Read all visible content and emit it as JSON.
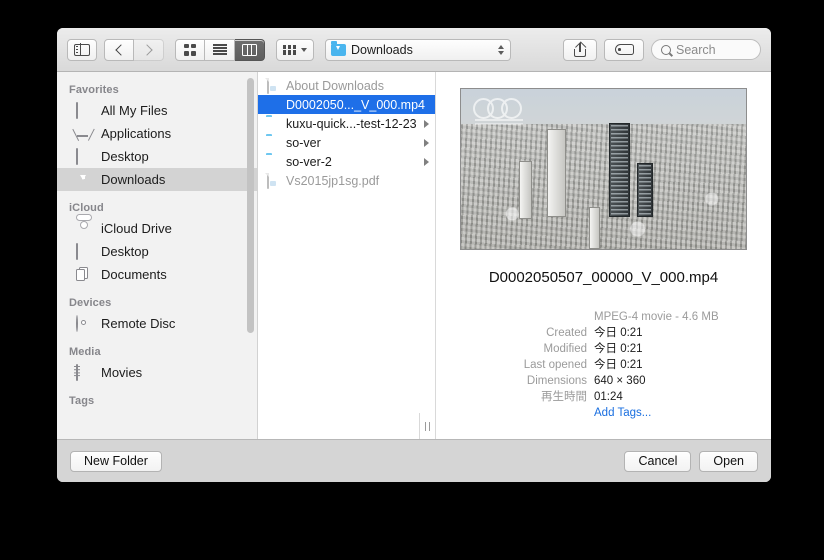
{
  "toolbar": {
    "sidebar_toggle_icon": "sidebar-toggle-icon",
    "back_icon": "chevron-left-icon",
    "forward_icon": "chevron-right-icon",
    "view_icon_label": "icon-view-icon",
    "view_list_label": "list-view-icon",
    "view_column_label": "column-view-icon",
    "arrange_icon": "arrange-grid-icon",
    "path_label": "Downloads",
    "path_icon": "downloads-folder-icon",
    "stepper_icon": "up-down-stepper-icon",
    "share_icon": "share-icon",
    "tag_icon": "tag-icon",
    "search_placeholder": "Search",
    "search_value": "",
    "search_icon": "magnifier-icon"
  },
  "sidebar": {
    "sections": [
      {
        "header": "Favorites",
        "items": [
          {
            "label": "All My Files",
            "icon": "all-my-files-icon",
            "selected": false
          },
          {
            "label": "Applications",
            "icon": "applications-icon",
            "selected": false
          },
          {
            "label": "Desktop",
            "icon": "desktop-icon",
            "selected": false
          },
          {
            "label": "Downloads",
            "icon": "downloads-icon",
            "selected": true
          }
        ]
      },
      {
        "header": "iCloud",
        "items": [
          {
            "label": "iCloud Drive",
            "icon": "icloud-drive-icon",
            "selected": false
          },
          {
            "label": "Desktop",
            "icon": "desktop-icon",
            "selected": false
          },
          {
            "label": "Documents",
            "icon": "documents-icon",
            "selected": false
          }
        ]
      },
      {
        "header": "Devices",
        "items": [
          {
            "label": "Remote Disc",
            "icon": "remote-disc-icon",
            "selected": false
          }
        ]
      },
      {
        "header": "Media",
        "items": [
          {
            "label": "Movies",
            "icon": "movies-icon",
            "selected": false
          }
        ]
      },
      {
        "header": "Tags",
        "items": []
      }
    ]
  },
  "file_list": {
    "rows": [
      {
        "name": "About Downloads",
        "icon": "document-icon",
        "selected": false,
        "dimmed": true,
        "has_arrow": false
      },
      {
        "name": "D0002050..._V_000.mp4",
        "icon": "movie-thumbnail-icon",
        "selected": true,
        "dimmed": false,
        "has_arrow": false
      },
      {
        "name": "kuxu-quick...-test-12-23",
        "icon": "folder-icon",
        "selected": false,
        "dimmed": false,
        "has_arrow": true
      },
      {
        "name": "so-ver",
        "icon": "folder-icon",
        "selected": false,
        "dimmed": false,
        "has_arrow": true
      },
      {
        "name": "so-ver-2",
        "icon": "folder-icon",
        "selected": false,
        "dimmed": false,
        "has_arrow": true
      },
      {
        "name": "Vs2015jp1sg.pdf",
        "icon": "document-icon",
        "selected": false,
        "dimmed": true,
        "has_arrow": false
      }
    ],
    "resize_grip_icon": "column-resize-grip-icon"
  },
  "preview": {
    "thumbnail_icon": "video-thumbnail-cityscape",
    "file_name": "D0002050507_00000_V_000.mp4",
    "kind_and_size": "MPEG-4 movie - 4.6 MB",
    "metadata": [
      {
        "label": "Created",
        "value": "今日 0:21"
      },
      {
        "label": "Modified",
        "value": "今日 0:21"
      },
      {
        "label": "Last opened",
        "value": "今日 0:21"
      },
      {
        "label": "Dimensions",
        "value": "640 × 360"
      },
      {
        "label": "再生時間",
        "value": "01:24"
      }
    ],
    "add_tags_label": "Add Tags..."
  },
  "bottom_bar": {
    "new_folder_label": "New Folder",
    "cancel_label": "Cancel",
    "open_label": "Open"
  },
  "colors": {
    "selection_blue": "#1e6fe8",
    "link_blue": "#1a6fe0",
    "sidebar_bg": "#f2f2f2",
    "toolbar_bg": "#ececec",
    "bottom_bar_bg": "#d5d5d5"
  }
}
